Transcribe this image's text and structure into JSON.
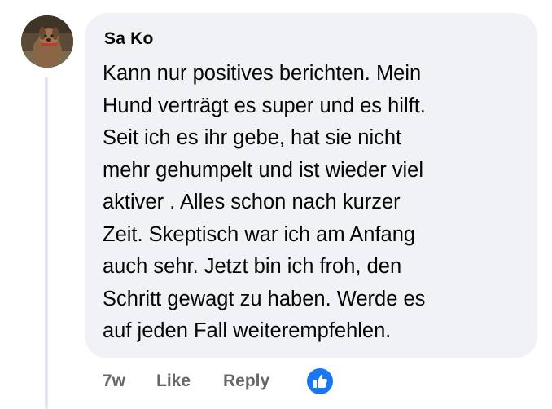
{
  "comment": {
    "author": "Sa Ko",
    "avatar_icon": "dog-avatar-photo",
    "text_lines": [
      "Kann nur positives berichten. Mein",
      "Hund verträgt es super und es hilft.",
      "Seit ich es ihr gebe, hat sie nicht",
      "mehr gehumpelt und ist wieder viel",
      "aktiver . Alles schon nach kurzer",
      "Zeit. Skeptisch war ich am Anfang",
      "auch sehr. Jetzt bin ich froh, den",
      "Schritt gewagt zu haben. Werde es",
      "auf jeden Fall weiterempfehlen."
    ]
  },
  "actions": {
    "timestamp": "7w",
    "like_label": "Like",
    "reply_label": "Reply",
    "reaction_icon": "thumbs-up-icon",
    "reaction_color": "#1877f2"
  },
  "colors": {
    "bubble_bg": "#f0f2f5",
    "text": "#050505",
    "secondary_text": "#65676b"
  }
}
